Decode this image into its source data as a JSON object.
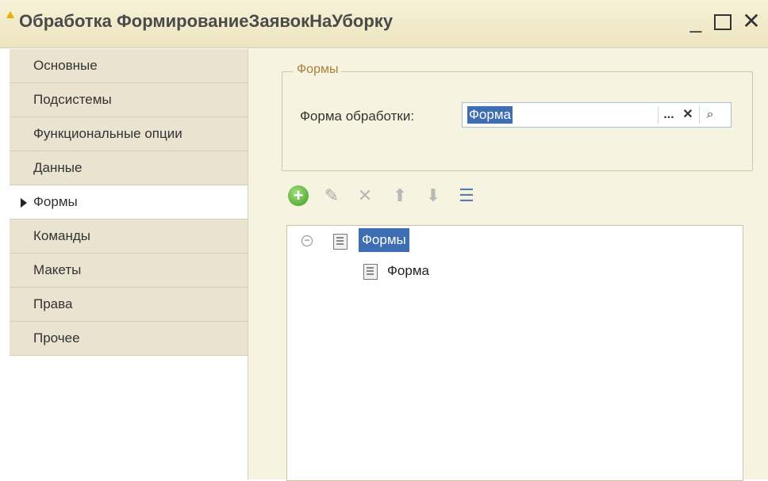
{
  "window": {
    "title": "Обработка ФормированиеЗаявокНаУборку",
    "minimize": "_",
    "close": "✕"
  },
  "sidebar": {
    "items": [
      {
        "label": "Основные"
      },
      {
        "label": "Подсистемы"
      },
      {
        "label": "Функциональные опции"
      },
      {
        "label": "Данные"
      },
      {
        "label": "Формы",
        "active": true
      },
      {
        "label": "Команды"
      },
      {
        "label": "Макеты"
      },
      {
        "label": "Права"
      },
      {
        "label": "Прочее"
      }
    ]
  },
  "forms_group": {
    "title": "Формы",
    "field_label": "Форма обработки:",
    "field_value": "Форма",
    "buttons": {
      "select": "...",
      "clear": "✕",
      "search": "⌕"
    }
  },
  "toolbar": {
    "icons": [
      "add-icon",
      "edit-icon",
      "delete-icon",
      "move-up-icon",
      "move-down-icon",
      "sort-icon"
    ]
  },
  "tree": {
    "root_label": "Формы",
    "child_label": "Форма"
  },
  "colors": {
    "selection": "#3d6db3",
    "group_title": "#a9813b",
    "nav_bg": "#e9e3cf",
    "main_bg": "#f7f3e1"
  }
}
